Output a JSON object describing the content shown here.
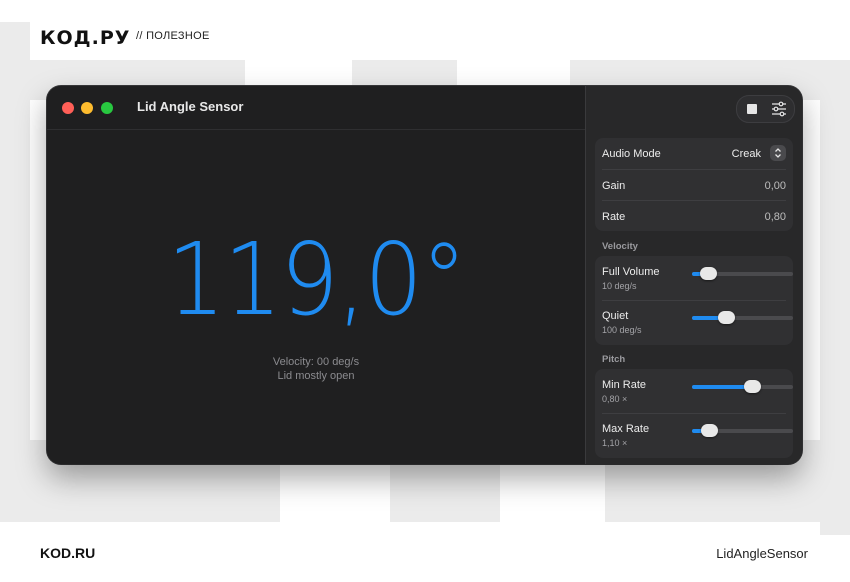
{
  "header": {
    "logo": "КОД.РУ",
    "tag": "// ПОЛЕЗНОЕ"
  },
  "footer": {
    "left": "KOD.RU",
    "right": "LidAngleSensor"
  },
  "window": {
    "title": "Lid Angle Sensor",
    "angle": "119,0°",
    "velocity": "Velocity: 00 deg/s",
    "status": "Lid mostly open"
  },
  "sidebar": {
    "toolbar": {
      "stop_icon": "stop-icon",
      "settings_icon": "sliders-icon"
    },
    "audio": {
      "mode_label": "Audio Mode",
      "mode_value": "Creak",
      "gain_label": "Gain",
      "gain_value": "0,00",
      "rate_label": "Rate",
      "rate_value": "0,80"
    },
    "velocity_section": {
      "heading": "Velocity",
      "full_volume": {
        "label": "Full Volume",
        "value": "10 deg/s",
        "level": 0.16
      },
      "quiet": {
        "label": "Quiet",
        "value": "100 deg/s",
        "level": 0.34
      }
    },
    "pitch_section": {
      "heading": "Pitch",
      "min_rate": {
        "label": "Min Rate",
        "value": "0,80 ×",
        "level": 0.59
      },
      "max_rate": {
        "label": "Max Rate",
        "value": "1,10 ×",
        "level": 0.17
      }
    }
  },
  "colors": {
    "accent": "#1f8bf0",
    "window_bg": "#1f1f20",
    "sidebar_bg": "#282829"
  }
}
